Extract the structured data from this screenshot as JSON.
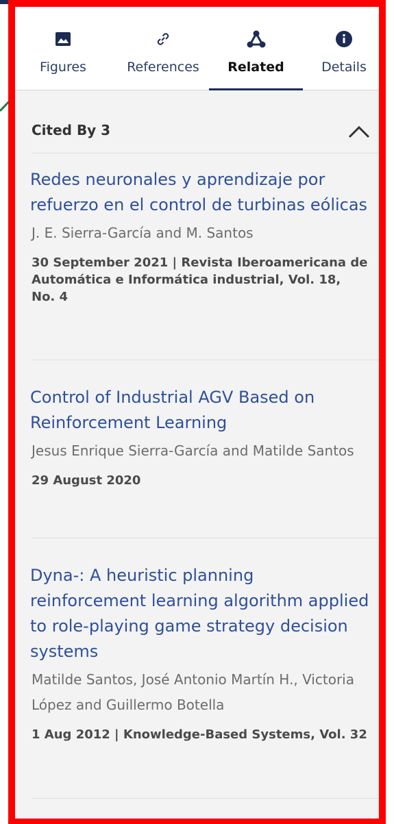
{
  "tabs": [
    {
      "label": "Figures",
      "icon": "image-icon",
      "active": false
    },
    {
      "label": "References",
      "icon": "link-icon",
      "active": false
    },
    {
      "label": "Related",
      "icon": "network-icon",
      "active": true
    },
    {
      "label": "Details",
      "icon": "info-icon",
      "active": false
    }
  ],
  "section": {
    "title": "Cited By 3",
    "toggle_icon": "chevron-up-icon"
  },
  "items": [
    {
      "title_lines": [
        "Redes neuronales y aprendizaje por",
        "refuerzo en el control de turbinas eólicas"
      ],
      "authors_lines": [
        "J. E. Sierra-García and M. Santos"
      ],
      "meta_lines": [
        "30 September 2021 | Revista Iberoamericana de",
        "Automática e Informática industrial, Vol. 18,",
        "No. 4"
      ]
    },
    {
      "title_lines": [
        "Control of Industrial AGV Based on",
        "Reinforcement Learning"
      ],
      "authors_lines": [
        "Jesus Enrique Sierra-García and Matilde Santos"
      ],
      "meta_lines": [
        "29 August 2020"
      ]
    },
    {
      "title_lines": [
        "Dyna-: A heuristic planning",
        "reinforcement learning algorithm applied",
        "to role-playing game strategy decision",
        "systems"
      ],
      "authors_lines": [
        "Matilde Santos, José Antonio Martín H., Victoria",
        "López and Guillermo Botella"
      ],
      "meta_lines": [
        "1 Aug 2012 | Knowledge-Based Systems, Vol. 32"
      ]
    }
  ],
  "colors": {
    "link": "#2e4f9e",
    "highlight_border": "#ff0000",
    "annotation_arrow": "#1f7a3c",
    "active_tab_indicator": "#1c2c55"
  }
}
